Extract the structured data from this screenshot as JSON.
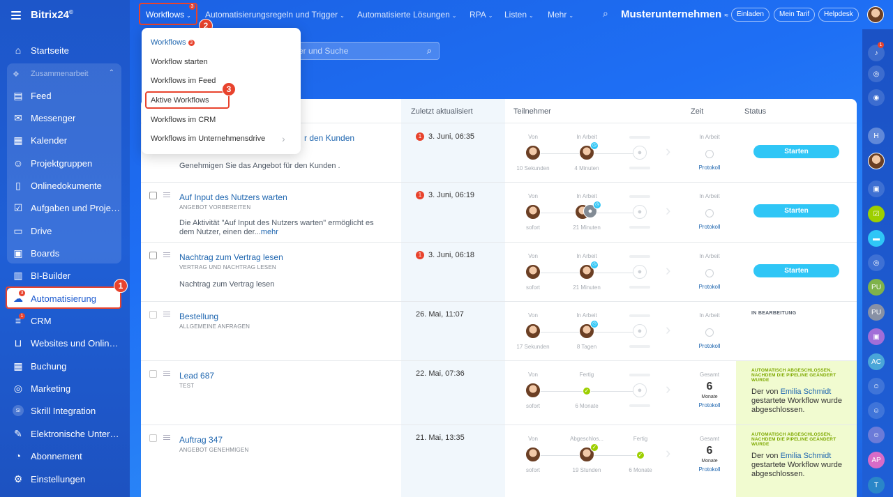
{
  "app": {
    "logo": "Bitrix24",
    "logo_mark": "©"
  },
  "topbar": {
    "menu": [
      "Workflows",
      "Automatisierungsregeln und Trigger",
      "Automatisierte Lösungen",
      "RPA",
      "Listen",
      "Mehr"
    ],
    "workflows_badge": "3",
    "company": "Musterunternehmen",
    "buttons": [
      "Einladen",
      "Mein Tarif",
      "Helpdesk"
    ]
  },
  "sidebar": {
    "items": [
      {
        "label": "Startseite",
        "icon": "home-icon"
      },
      {
        "label": "Zusammenarbeit",
        "icon": "collab-icon"
      },
      {
        "label": "Feed",
        "icon": "feed-icon"
      },
      {
        "label": "Messenger",
        "icon": "messenger-icon"
      },
      {
        "label": "Kalender",
        "icon": "calendar-icon"
      },
      {
        "label": "Projektgruppen",
        "icon": "groups-icon"
      },
      {
        "label": "Onlinedokumente",
        "icon": "document-icon"
      },
      {
        "label": "Aufgaben und Projek...",
        "icon": "tasks-icon"
      },
      {
        "label": "Drive",
        "icon": "drive-icon"
      },
      {
        "label": "Boards",
        "icon": "boards-icon"
      },
      {
        "label": "BI-Builder",
        "icon": "chart-icon"
      },
      {
        "label": "Automatisierung",
        "icon": "automation-icon"
      },
      {
        "label": "CRM",
        "icon": "crm-icon"
      },
      {
        "label": "Websites und Onlines...",
        "icon": "cart-icon"
      },
      {
        "label": "Buchung",
        "icon": "booking-icon"
      },
      {
        "label": "Marketing",
        "icon": "marketing-icon"
      },
      {
        "label": "Skrill Integration",
        "icon": "skrill-icon"
      },
      {
        "label": "Elektronische Untersc...",
        "icon": "signature-icon"
      },
      {
        "label": "Abonnement",
        "icon": "subscription-icon"
      },
      {
        "label": "Einstellungen",
        "icon": "settings-icon"
      }
    ],
    "automation_badge": "3",
    "crm_badge": "1",
    "skrill_abbr": "SI"
  },
  "search": {
    "placeholder": "er und Suche"
  },
  "dropdown": {
    "items": [
      "Workflows",
      "Workflow starten",
      "Workflows im Feed",
      "Aktive Workflows",
      "Workflows im CRM",
      "Workflows im Unternehmensdrive"
    ],
    "badge": "3"
  },
  "annotations": [
    "1",
    "2",
    "3",
    "3"
  ],
  "table": {
    "headers": [
      "Zuletzt aktualisiert",
      "Teilnehmer",
      "Zeit",
      "Status"
    ],
    "rows": [
      {
        "title": "r den Kunden",
        "subtitle": "",
        "desc": "Genehmigen Sie das Angebot  für den Kunden .",
        "more": "",
        "date": "3. Juni, 06:35",
        "error": "1",
        "s1": "Von",
        "s1sub": "10 Sekunden",
        "s2": "In Arbeit",
        "s2sub": "4 Minuten",
        "time_lbl": "In Arbeit",
        "protocol": "Protokoll",
        "status": "Starten"
      },
      {
        "title": "Auf Input des Nutzers warten",
        "subtitle": "ANGEBOT VORBEREITEN",
        "desc": "Die Aktivität \"Auf Input des Nutzers warten\" ermöglicht es dem Nutzer, einen der...",
        "more": "mehr",
        "date": "3. Juni, 06:19",
        "error": "1",
        "s1": "Von",
        "s1sub": "sofort",
        "s2": "In Arbeit",
        "s2sub": "21 Minuten",
        "time_lbl": "In Arbeit",
        "protocol": "Protokoll",
        "status": "Starten"
      },
      {
        "title": "Nachtrag zum Vertrag lesen",
        "subtitle": "VERTRAG UND NACHTRAG LESEN",
        "desc": "Nachtrag zum Vertrag lesen",
        "more": "",
        "date": "3. Juni, 06:18",
        "error": "1",
        "s1": "Von",
        "s1sub": "sofort",
        "s2": "In Arbeit",
        "s2sub": "21 Minuten",
        "time_lbl": "In Arbeit",
        "protocol": "Protokoll",
        "status": "Starten"
      },
      {
        "title": "Bestellung",
        "subtitle": "ALLGEMEINE ANFRAGEN",
        "desc": "",
        "more": "",
        "date": "26. Mai, 11:07",
        "error": "",
        "s1": "Von",
        "s1sub": "17 Sekunden",
        "s2": "In Arbeit",
        "s2sub": "8 Tagen",
        "time_lbl": "In Arbeit",
        "protocol": "Protokoll",
        "status": "IN BEARBEITUNG"
      },
      {
        "title": "Lead 687",
        "subtitle": "TEST",
        "desc": "",
        "more": "",
        "date": "22. Mai, 07:36",
        "error": "",
        "s1": "Von",
        "s1sub": "sofort",
        "s2": "Fertig",
        "s2sub": "6 Monate",
        "time_lbl": "Gesamt",
        "time_num": "6",
        "time_unit": "Monate",
        "protocol": "Protokoll",
        "status_head": "AUTOMATISCH ABGESCHLOSSEN, NACHDEM DIE PIPELINE GEÄNDERT WURDE",
        "status_pre": "Der von ",
        "status_link": "Emilia Schmidt",
        "status_post": " gestartete Workflow wurde abgeschlossen."
      },
      {
        "title": "Auftrag 347",
        "subtitle": "ANGEBOT GENEHMIGEN",
        "desc": "",
        "more": "",
        "date": "21. Mai, 13:35",
        "error": "",
        "s1": "Von",
        "s1sub": "sofort",
        "s2": "Abgeschlos...",
        "s2sub": "19 Stunden",
        "s3": "Fertig",
        "s3sub": "6 Monate",
        "time_lbl": "Gesamt",
        "time_num": "6",
        "time_unit": "Monate",
        "protocol": "Protokoll",
        "status_head": "AUTOMATISCH ABGESCHLOSSEN, NACHDEM DIE PIPELINE GEÄNDERT WURDE",
        "status_pre": "Der von ",
        "status_link": "Emilia Schmidt",
        "status_post": " gestartete Workflow wurde abgeschlossen."
      }
    ]
  },
  "rightbar": {
    "notif_badge": "1",
    "items": [
      "H",
      "PU",
      "PU",
      "AC",
      "AP",
      "T"
    ]
  },
  "colors": {
    "accent": "#2fc6f6",
    "brand": "#1f5fd6",
    "annotation": "#e8432d",
    "done_bg": "#f1fbd0"
  }
}
